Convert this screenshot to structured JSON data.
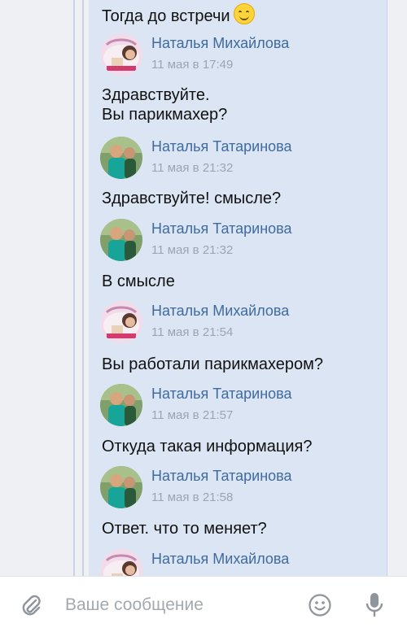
{
  "messages": [
    {
      "text": "Тогда до встречи"
    },
    {
      "author": "Наталья Михайлова",
      "time": "11 мая в 17:49",
      "avatar": "avatar-mikhailova",
      "text": "Здравствуйте.\nВы парикмахер?"
    },
    {
      "author": "Наталья Татаринова",
      "time": "11 мая в 21:32",
      "avatar": "avatar-tatarinova",
      "text": "Здравствуйте!  смысле?"
    },
    {
      "author": "Наталья Татаринова",
      "time": "11 мая в 21:32",
      "avatar": "avatar-tatarinova",
      "text": "В смысле"
    },
    {
      "author": "Наталья Михайлова",
      "time": "11 мая в 21:54",
      "avatar": "avatar-mikhailova",
      "text": "Вы работали парикмахером?"
    },
    {
      "author": "Наталья Татаринова",
      "time": "11 мая в 21:57",
      "avatar": "avatar-tatarinova",
      "text": "Откуда такая информация?"
    },
    {
      "author": "Наталья Татаринова",
      "time": "11 мая в 21:58",
      "avatar": "avatar-tatarinova",
      "text": "Ответ.  что то меняет?"
    },
    {
      "author": "Наталья Михайлова",
      "time": "",
      "avatar": "avatar-mikhailova",
      "text": ""
    }
  ],
  "composer": {
    "placeholder": "Ваше сообщение",
    "icons": [
      "paperclip-icon",
      "emoji-icon",
      "microphone-icon"
    ]
  },
  "colors": {
    "author": "#3f6b9e",
    "time": "#9aa6b4",
    "selected_bg": "#dbe5f3",
    "thread_line": "#c7d3e3"
  }
}
